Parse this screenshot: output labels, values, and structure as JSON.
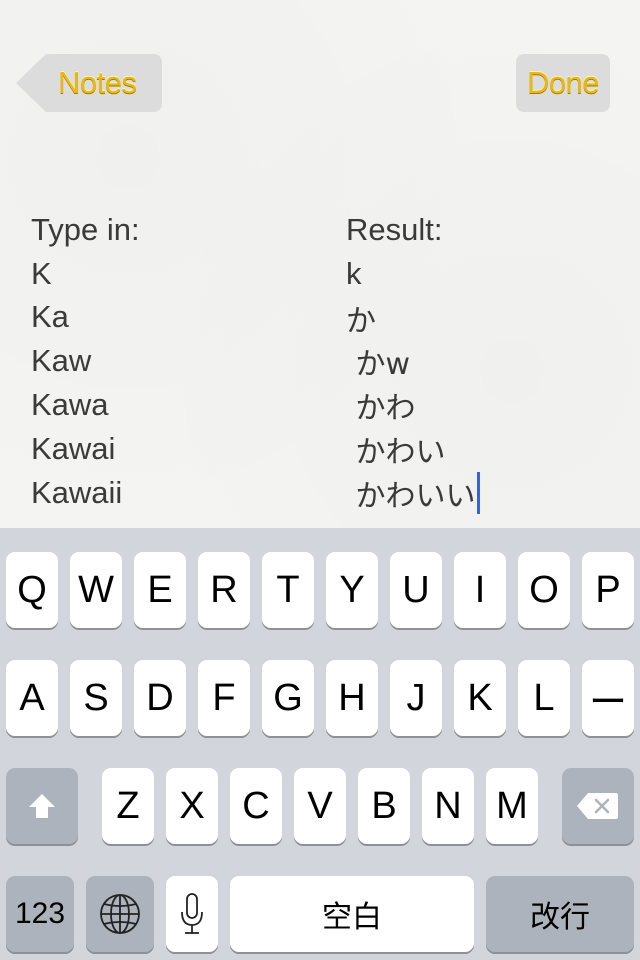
{
  "nav": {
    "back_label": "Notes",
    "done_label": "Done"
  },
  "note": {
    "header": {
      "type_in": "Type in:",
      "result": "Result:"
    },
    "rows": [
      {
        "type_in": "K",
        "result": "k"
      },
      {
        "type_in": "Ka",
        "result": "か"
      },
      {
        "type_in": "Kaw",
        "result": " かw"
      },
      {
        "type_in": "Kawa",
        "result": " かわ"
      },
      {
        "type_in": "Kawai",
        "result": " かわい"
      },
      {
        "type_in": "Kawaii",
        "result": " かわいい"
      }
    ],
    "cursor_color": "#3a62d8"
  },
  "keyboard": {
    "row1": [
      "Q",
      "W",
      "E",
      "R",
      "T",
      "Y",
      "U",
      "I",
      "O",
      "P"
    ],
    "row2": [
      "A",
      "S",
      "D",
      "F",
      "G",
      "H",
      "J",
      "K",
      "L",
      "ー"
    ],
    "row3": [
      "Z",
      "X",
      "C",
      "V",
      "B",
      "N",
      "M"
    ],
    "shift_icon": "shift-arrow-icon",
    "delete_icon": "backspace-icon",
    "numbers_label": "123",
    "globe_icon": "globe-icon",
    "mic_icon": "microphone-icon",
    "space_label": "空白",
    "return_label": "改行"
  },
  "colors": {
    "accent": "#e8b818",
    "keyboard_bg": "#d2d5db",
    "key_bg": "#ffffff",
    "special_key_bg": "#adb3bd"
  }
}
